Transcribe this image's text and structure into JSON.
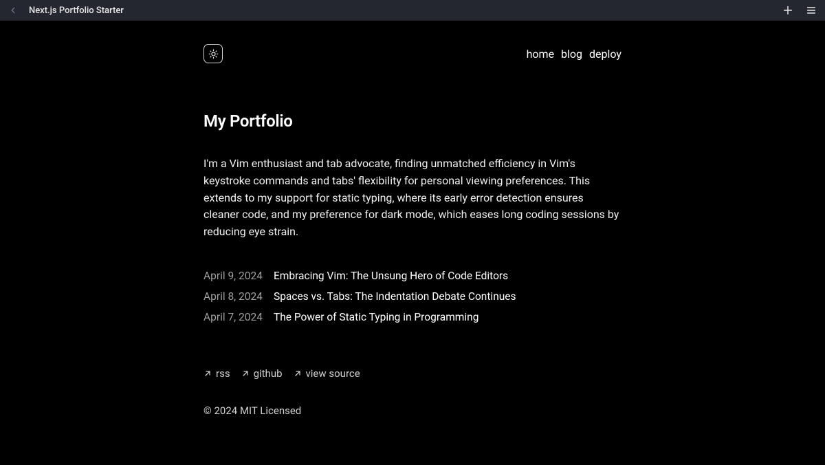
{
  "topbar": {
    "title": "Next.js Portfolio Starter"
  },
  "nav": {
    "links": [
      {
        "label": "home"
      },
      {
        "label": "blog"
      },
      {
        "label": "deploy"
      }
    ]
  },
  "main": {
    "title": "My Portfolio",
    "intro": "I'm a Vim enthusiast and tab advocate, finding unmatched efficiency in Vim's keystroke commands and tabs' flexibility for personal viewing preferences. This extends to my support for static typing, where its early error detection ensures cleaner code, and my preference for dark mode, which eases long coding sessions by reducing eye strain."
  },
  "posts": [
    {
      "date": "April 9, 2024",
      "title": "Embracing Vim: The Unsung Hero of Code Editors"
    },
    {
      "date": "April 8, 2024",
      "title": "Spaces vs. Tabs: The Indentation Debate Continues"
    },
    {
      "date": "April 7, 2024",
      "title": "The Power of Static Typing in Programming"
    }
  ],
  "footer": {
    "links": [
      {
        "label": "rss"
      },
      {
        "label": "github"
      },
      {
        "label": "view source"
      }
    ],
    "license": "© 2024 MIT Licensed"
  }
}
